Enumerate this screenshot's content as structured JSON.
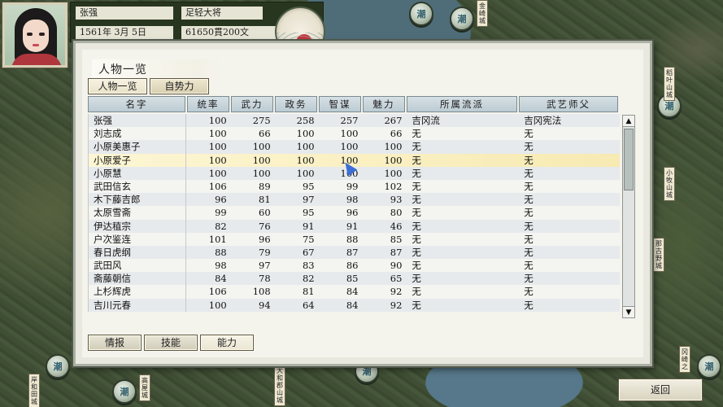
{
  "player": {
    "name": "张强",
    "rank": "足轻大将",
    "date": "1561年 3月 5日",
    "money": "61650貫200文"
  },
  "panel": {
    "title": "人物一览",
    "tabs": [
      "人物一览",
      "自势力"
    ],
    "bottom_tabs": [
      "情报",
      "技能",
      "能力"
    ]
  },
  "table": {
    "headers": [
      "名字",
      "统率",
      "武力",
      "政务",
      "智谋",
      "魅力",
      "所属流派",
      "武艺师父"
    ],
    "rows": [
      {
        "name": "张强",
        "cmd": "100",
        "war": "275",
        "pol": "258",
        "int": "257",
        "cha": "267",
        "school": "吉冈流",
        "master": "吉冈宪法"
      },
      {
        "name": "刘志成",
        "cmd": "100",
        "war": "66",
        "pol": "100",
        "int": "100",
        "cha": "66",
        "school": "无",
        "master": "无"
      },
      {
        "name": "小原美惠子",
        "cmd": "100",
        "war": "100",
        "pol": "100",
        "int": "100",
        "cha": "100",
        "school": "无",
        "master": "无"
      },
      {
        "name": "小原爱子",
        "cmd": "100",
        "war": "100",
        "pol": "100",
        "int": "100",
        "cha": "100",
        "school": "无",
        "master": "无"
      },
      {
        "name": "小原慧",
        "cmd": "100",
        "war": "100",
        "pol": "100",
        "int": "100",
        "cha": "100",
        "school": "无",
        "master": "无"
      },
      {
        "name": "武田信玄",
        "cmd": "106",
        "war": "89",
        "pol": "95",
        "int": "99",
        "cha": "102",
        "school": "无",
        "master": "无"
      },
      {
        "name": "木下藤吉郎",
        "cmd": "96",
        "war": "81",
        "pol": "97",
        "int": "98",
        "cha": "93",
        "school": "无",
        "master": "无"
      },
      {
        "name": "太原雪斋",
        "cmd": "99",
        "war": "60",
        "pol": "95",
        "int": "96",
        "cha": "80",
        "school": "无",
        "master": "无"
      },
      {
        "name": "伊达稙宗",
        "cmd": "82",
        "war": "76",
        "pol": "91",
        "int": "91",
        "cha": "46",
        "school": "无",
        "master": "无"
      },
      {
        "name": "户次鉴连",
        "cmd": "101",
        "war": "96",
        "pol": "75",
        "int": "88",
        "cha": "85",
        "school": "无",
        "master": "无"
      },
      {
        "name": "春日虎纲",
        "cmd": "88",
        "war": "79",
        "pol": "67",
        "int": "87",
        "cha": "87",
        "school": "无",
        "master": "无"
      },
      {
        "name": "武田风",
        "cmd": "98",
        "war": "97",
        "pol": "83",
        "int": "86",
        "cha": "90",
        "school": "无",
        "master": "无"
      },
      {
        "name": "斋藤朝信",
        "cmd": "84",
        "war": "78",
        "pol": "82",
        "int": "85",
        "cha": "65",
        "school": "无",
        "master": "无"
      },
      {
        "name": "上杉辉虎",
        "cmd": "106",
        "war": "108",
        "pol": "81",
        "int": "84",
        "cha": "92",
        "school": "无",
        "master": "无"
      },
      {
        "name": "吉川元春",
        "cmd": "100",
        "war": "94",
        "pol": "64",
        "int": "84",
        "cha": "92",
        "school": "无",
        "master": "无"
      }
    ],
    "selected_row": 3
  },
  "buttons": {
    "return": "返回",
    "scroll_up": "▲",
    "scroll_down": "▼"
  },
  "map": {
    "castle_labels": [
      "稻叶山城",
      "小牧山城",
      "那古野城",
      "冈崎之",
      "高屋城",
      "大和郡山城",
      "岸和田城",
      "金崎城"
    ]
  }
}
